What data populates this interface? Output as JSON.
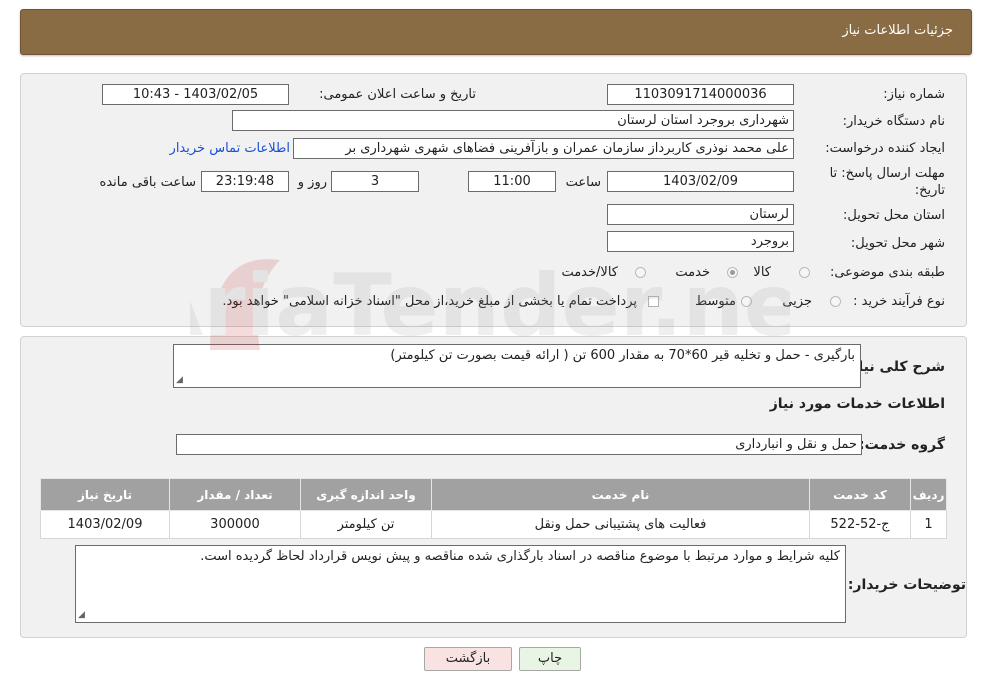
{
  "header": {
    "title": "جزئیات اطلاعات نیاز"
  },
  "details": {
    "need_number_label": "شماره نیاز:",
    "need_number": "1103091714000036",
    "announce_label": "تاریخ و ساعت اعلان عمومی:",
    "announce_value": "1403/02/05 - 10:43",
    "buyer_org_label": "نام دستگاه خریدار:",
    "buyer_org": "شهرداری بروجرد استان لرستان",
    "creator_label": "ایجاد کننده درخواست:",
    "creator": "علی محمد نوذری کاربرداز سازمان عمران و بازآفرینی فضاهای شهری شهرداری بر",
    "contact_link": "اطلاعات تماس خریدار",
    "deadline_label_1": "مهلت ارسال پاسخ: تا",
    "deadline_label_2": "تاریخ:",
    "deadline_date": "1403/02/09",
    "time_label": "ساعت",
    "deadline_time": "11:00",
    "days_value": "3",
    "days_label": "روز و",
    "remaining_time": "23:19:48",
    "remaining_label": "ساعت باقی مانده",
    "province_label": "استان محل تحویل:",
    "province": "لرستان",
    "city_label": "شهر محل تحویل:",
    "city": "بروجرد",
    "category_label": "طبقه بندی موضوعی:",
    "category_options": [
      "کالا",
      "خدمت",
      "کالا/خدمت"
    ],
    "category_selected": "خدمت",
    "process_label": "نوع فرآیند خرید :",
    "process_options": [
      "جزیی",
      "متوسط"
    ],
    "payment_note": "پرداخت تمام یا بخشی از مبلغ خرید،از محل \"اسناد خزانه اسلامی\" خواهد بود."
  },
  "description": {
    "label": "شرح کلی نیاز:",
    "text": "بارگیری - حمل و تخلیه قیر 60*70 به مقدار 600 تن ( ارائه قیمت بصورت تن کیلومتر)"
  },
  "services": {
    "section_title": "اطلاعات خدمات مورد نیاز",
    "group_label": "گروه خدمت:",
    "group_value": "حمل و نقل و انبارداری",
    "columns": [
      "ردیف",
      "کد خدمت",
      "نام خدمت",
      "واحد اندازه گیری",
      "تعداد / مقدار",
      "تاریخ نیاز"
    ],
    "rows": [
      [
        "1",
        "ج-52-522",
        "فعالیت های پشتیبانی حمل ونقل",
        "تن کیلومتر",
        "300000",
        "1403/02/09"
      ]
    ]
  },
  "buyer_notes": {
    "label": "توضیحات خریدار:",
    "text": "کلیه شرایط و موارد مرتبط با موضوع مناقصه در اسناد بارگذاری شده مناقصه و پیش نویس قرارداد لحاظ گردیده است."
  },
  "buttons": {
    "print": "چاپ",
    "back": "بازگشت"
  },
  "watermark": {
    "text": "AriaTender.net"
  },
  "colors": {
    "header": "#8a6c44",
    "link": "#1a4fd6",
    "table_header": "#a1a1a1"
  }
}
